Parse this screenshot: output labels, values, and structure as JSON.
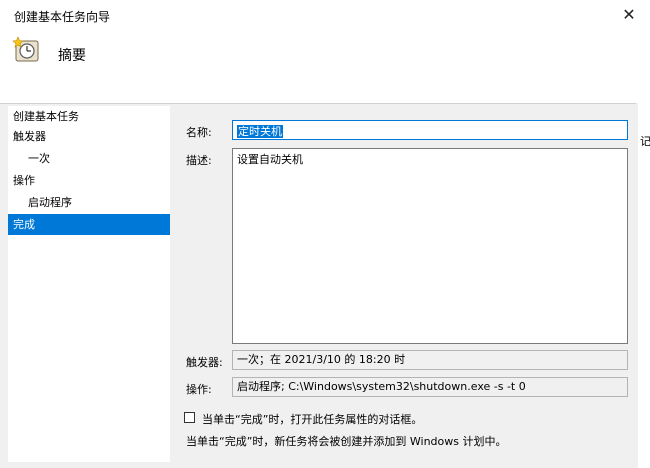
{
  "window": {
    "title": "创建基本任务向导",
    "close_glyph": "✕"
  },
  "header": {
    "title": "摘要",
    "icon": "clock-wizard-icon"
  },
  "edge_fragment": "记",
  "sidebar": {
    "items": [
      {
        "label": "创建基本任务",
        "level": 0,
        "selected": false
      },
      {
        "label": "触发器",
        "level": 0,
        "selected": false
      },
      {
        "label": "一次",
        "level": 1,
        "selected": false
      },
      {
        "label": "操作",
        "level": 0,
        "selected": false
      },
      {
        "label": "启动程序",
        "level": 1,
        "selected": false
      },
      {
        "label": "完成",
        "level": 0,
        "selected": true
      }
    ]
  },
  "form": {
    "name_label": "名称:",
    "name_value": "定时关机",
    "desc_label": "描述:",
    "desc_value": "设置自动关机",
    "trigger_label": "触发器:",
    "trigger_value": "一次；在 2021/3/10 的 18:20 时",
    "action_label": "操作:",
    "action_value": "启动程序; C:\\Windows\\system32\\shutdown.exe -s -t 0"
  },
  "checkbox": {
    "checked": false,
    "label": "当单击“完成”时，打开此任务属性的对话框。"
  },
  "info": "当单击“完成”时，新任务将会被创建并添加到 Windows 计划中。",
  "colors": {
    "selection": "#0078d7",
    "background": "#f0f0f0"
  }
}
